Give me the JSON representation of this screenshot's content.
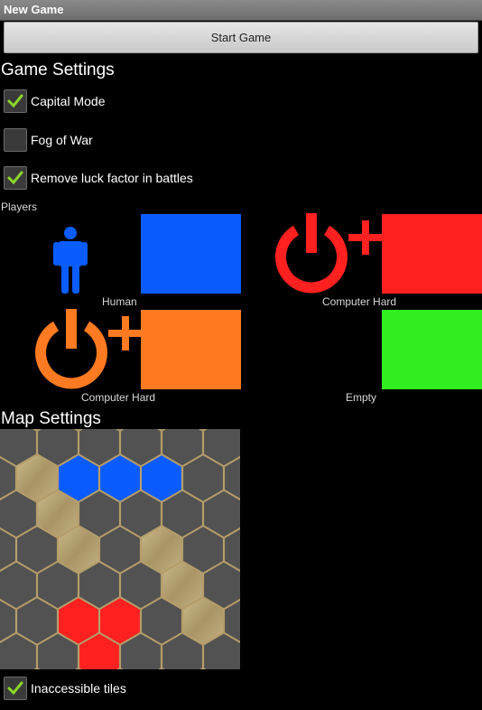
{
  "window": {
    "title": "New Game"
  },
  "toolbar": {
    "start_label": "Start Game"
  },
  "game_settings": {
    "heading": "Game Settings",
    "options": [
      {
        "label": "Capital Mode",
        "checked": true
      },
      {
        "label": "Fog of War",
        "checked": false
      },
      {
        "label": "Remove luck factor in battles",
        "checked": true
      }
    ]
  },
  "players": {
    "heading": "Players",
    "items": [
      {
        "type": "Human",
        "icon": "human-icon",
        "color": "#0a5cff"
      },
      {
        "type": "Computer Hard",
        "icon": "power-plus-icon",
        "color": "#ff2020"
      },
      {
        "type": "Computer Hard",
        "icon": "power-plus-icon",
        "color": "#ff7a20"
      },
      {
        "type": "Empty",
        "icon": "",
        "color": "#33ee1e"
      }
    ]
  },
  "map_settings": {
    "heading": "Map Settings",
    "option": {
      "label": "Inaccessible tiles",
      "checked": true
    }
  },
  "colors": {
    "check": "#8bd629",
    "hex_empty": "#525252",
    "hex_border": "#b59d6a",
    "sand": "#b9a679"
  }
}
